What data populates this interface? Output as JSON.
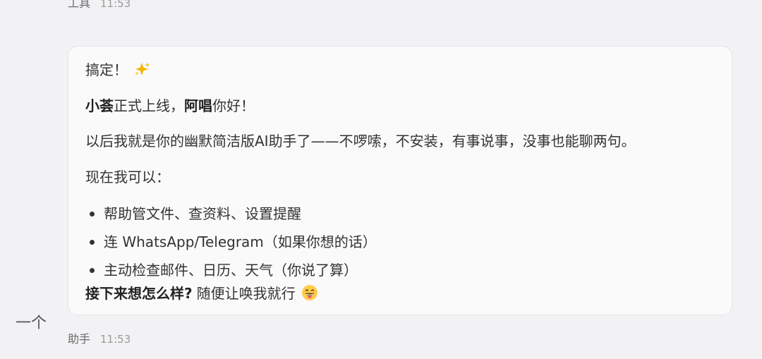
{
  "previous_message": {
    "sender": "工具",
    "time": "11:53"
  },
  "message": {
    "line1": "搞定！",
    "line1_emoji": "sparkles-icon",
    "line2_bold1": "小荟",
    "line2_text1": "正式上线，",
    "line2_bold2": "阿唱",
    "line2_text2": "你好！",
    "line3": "以后我就是你的幽默简洁版AI助手了——不啰嗦，不安装，有事说事，没事也能聊两句。",
    "line4": "现在我可以：",
    "bullets": [
      "帮助管文件、查资料、设置提醒",
      "连 WhatsApp/Telegram（如果你想的话）",
      "主动检查邮件、日历、天气（你说了算）"
    ],
    "closing_bold": "接下来想怎么样?",
    "closing_text": "随便让唤我就行",
    "closing_emoji": "grinning-face-icon"
  },
  "left_label": "一个",
  "current_message_meta": {
    "sender": "助手",
    "time": "11:53"
  }
}
